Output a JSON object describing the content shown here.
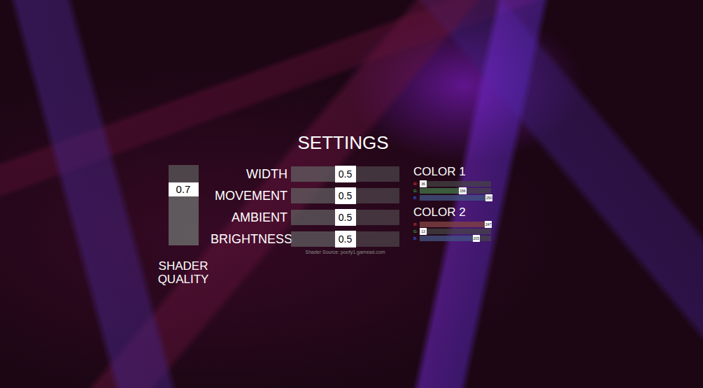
{
  "title": "SETTINGS",
  "quality": {
    "label": "SHADER QUALITY",
    "value": "0.7",
    "level": 0.7
  },
  "sliders": [
    {
      "label": "WIDTH",
      "value": "0.5",
      "level": 0.5
    },
    {
      "label": "MOVEMENT",
      "value": "0.5",
      "level": 0.5
    },
    {
      "label": "AMBIENT",
      "value": "0.5",
      "level": 0.5
    },
    {
      "label": "BRIGHTNESS",
      "value": "0.5",
      "level": 0.5
    }
  ],
  "source": "Shader Source: poofy1.gamead.com",
  "colors": [
    {
      "label": "COLOR 1",
      "channels": [
        {
          "name": "R:",
          "value": "36",
          "level": 0.05,
          "color": "#ff3b3b"
        },
        {
          "name": "G:",
          "value": "156",
          "level": 0.6,
          "color": "#3bd24a"
        },
        {
          "name": "B:",
          "value": "250",
          "level": 0.97,
          "color": "#3b6bff"
        }
      ]
    },
    {
      "label": "COLOR 2",
      "channels": [
        {
          "name": "R:",
          "value": "247",
          "level": 0.96,
          "color": "#ff3b3b"
        },
        {
          "name": "G:",
          "value": "13",
          "level": 0.05,
          "color": "#3bd24a"
        },
        {
          "name": "B:",
          "value": "205",
          "level": 0.79,
          "color": "#3b6bff"
        }
      ]
    }
  ]
}
